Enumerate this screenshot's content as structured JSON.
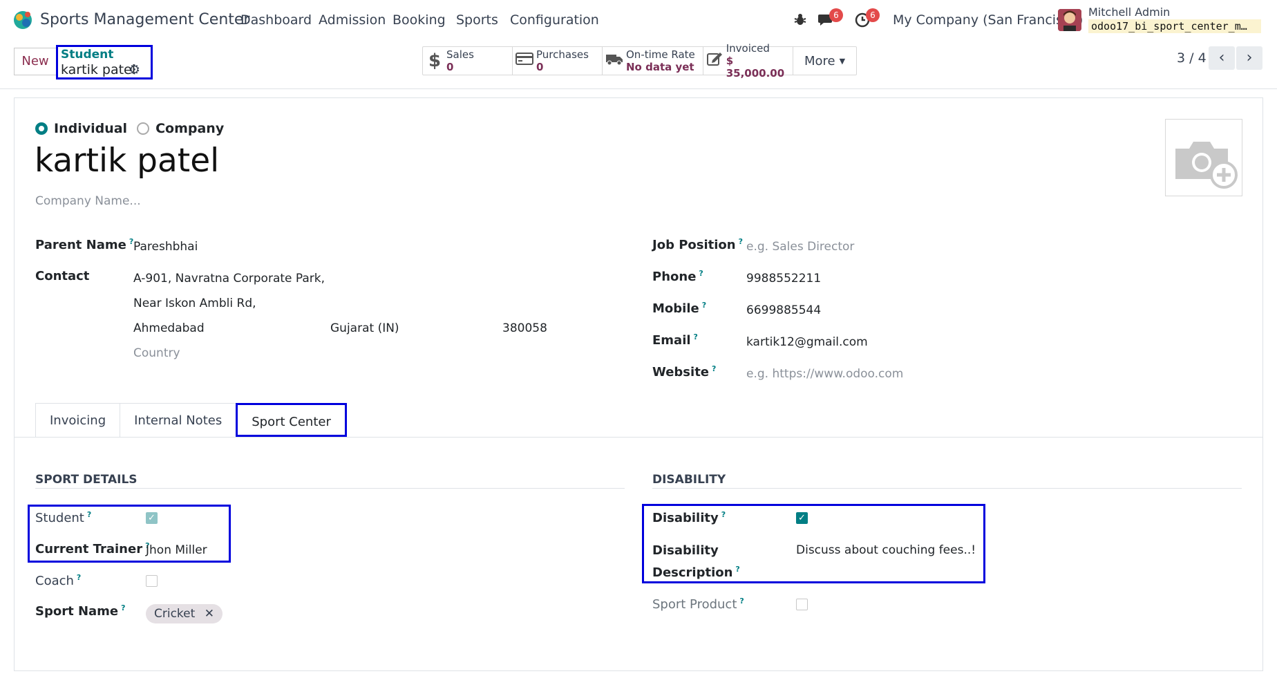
{
  "topbar": {
    "app_title": "Sports Management Center",
    "menu": [
      "Dashboard",
      "Admission",
      "Booking",
      "Sports",
      "Configuration"
    ],
    "chat_badge": "6",
    "activity_badge": "6",
    "company": "My Company (San Francisco)",
    "user_name": "Mitchell Admin",
    "db_name": "odoo17_bi_sport_center_m…"
  },
  "controlbar": {
    "new_label": "New",
    "breadcrumb_parent": "Student",
    "breadcrumb_current": "kartik patel",
    "smart_buttons": [
      {
        "label": "Sales",
        "value": "0",
        "icon": "dollar-icon"
      },
      {
        "label": "Purchases",
        "value": "0",
        "icon": "credit-card-icon"
      },
      {
        "label": "On-time Rate",
        "value": "No data yet",
        "icon": "truck-icon"
      },
      {
        "label": "Invoiced",
        "value": "$ 35,000.00",
        "icon": "edit-icon"
      }
    ],
    "more_label": "More",
    "pager": "3 / 4"
  },
  "form": {
    "type_individual": "Individual",
    "type_company": "Company",
    "name": "kartik patel",
    "company_name_placeholder": "Company Name...",
    "parent_name_label": "Parent Name",
    "parent_name": "Pareshbhai",
    "contact_label": "Contact",
    "street1": "A-901, Navratna Corporate Park,",
    "street2": "Near Iskon Ambli Rd,",
    "city": "Ahmedabad",
    "state": "Gujarat (IN)",
    "zip": "380058",
    "country_placeholder": "Country",
    "job_position_label": "Job Position",
    "job_position_placeholder": "e.g. Sales Director",
    "phone_label": "Phone",
    "phone": "9988552211",
    "mobile_label": "Mobile",
    "mobile": "6699885544",
    "email_label": "Email",
    "email": "kartik12@gmail.com",
    "website_label": "Website",
    "website_placeholder": "e.g. https://www.odoo.com"
  },
  "tabs": [
    "Invoicing",
    "Internal Notes",
    "Sport Center"
  ],
  "sport_center": {
    "sport_details_header": "SPORT DETAILS",
    "disability_header": "DISABILITY",
    "student_label": "Student",
    "student_checked": true,
    "current_trainer_label": "Current Trainer",
    "current_trainer": "Jhon Miller",
    "coach_label": "Coach",
    "coach_checked": false,
    "sport_name_label": "Sport Name",
    "sport_name_tag": "Cricket",
    "disability_label": "Disability",
    "disability_checked": true,
    "disability_description_label_1": "Disability",
    "disability_description_label_2": "Description",
    "disability_description": "Discuss about couching fees..!",
    "sport_product_label": "Sport Product",
    "sport_product_checked": false
  },
  "colors": {
    "accent": "#017e84",
    "brand": "#7b2f57",
    "highlight": "#0000dd",
    "badge": "#e34a4a"
  }
}
